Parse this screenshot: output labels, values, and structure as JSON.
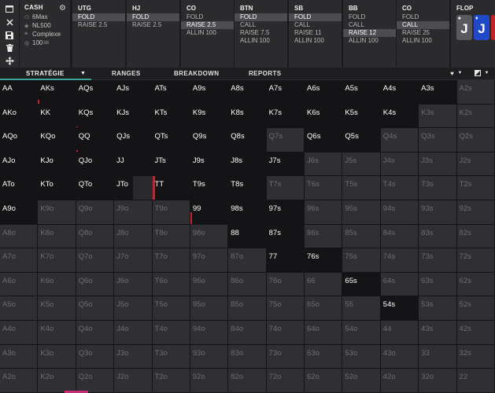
{
  "toolbar": {
    "icons": [
      "window-icon",
      "close-icon",
      "save-icon",
      "trash-icon",
      "move-icon"
    ]
  },
  "settings": {
    "title": "CASH",
    "rows": [
      {
        "icon": "players-icon",
        "text": "6Max",
        "suffix": ""
      },
      {
        "icon": "tag-icon",
        "text": "NL500",
        "suffix": ""
      },
      {
        "icon": "layers-icon",
        "text": "Complexe",
        "suffix": ""
      },
      {
        "icon": "chips-icon",
        "text": "100",
        "suffix": "bb"
      }
    ]
  },
  "positions": [
    {
      "name": "UTG",
      "actions": [
        "FOLD",
        "RAISE 2.5"
      ],
      "selected": 0
    },
    {
      "name": "HJ",
      "actions": [
        "FOLD",
        "RAISE 2.5"
      ],
      "selected": 0
    },
    {
      "name": "CO",
      "actions": [
        "FOLD",
        "RAISE 2.5",
        "ALLIN 100"
      ],
      "selected": 1
    },
    {
      "name": "BTN",
      "actions": [
        "FOLD",
        "CALL",
        "RAISE 7.5",
        "ALLIN 100"
      ],
      "selected": 0
    },
    {
      "name": "SB",
      "actions": [
        "FOLD",
        "CALL",
        "RAISE 11",
        "ALLIN 100"
      ],
      "selected": 0
    },
    {
      "name": "BB",
      "actions": [
        "FOLD",
        "CALL",
        "RAISE 12",
        "ALLIN 100"
      ],
      "selected": 2
    },
    {
      "name": "CO",
      "actions": [
        "FOLD",
        "CALL",
        "RAISE 25",
        "ALLIN 100"
      ],
      "selected": 1
    }
  ],
  "flop": {
    "title": "FLOP",
    "cards": [
      {
        "rank": "J",
        "suit": "♠",
        "color": "#5a5a5e"
      },
      {
        "rank": "J",
        "suit": "♦",
        "color": "#1f49c8"
      },
      {
        "rank": "",
        "suit": "",
        "color": "#c02226"
      }
    ]
  },
  "tabs": {
    "strategie": "STRATÉGIE",
    "ranges": "RANGES",
    "breakdown": "BREAKDOWN",
    "reports": "REPORTS"
  },
  "grid": {
    "rows": [
      [
        "AA",
        "AKs",
        "AQs",
        "AJs",
        "ATs",
        "A9s",
        "A8s",
        "A7s",
        "A6s",
        "A5s",
        "A4s",
        "A3s",
        "A2s"
      ],
      [
        "AKo",
        "KK",
        "KQs",
        "KJs",
        "KTs",
        "K9s",
        "K8s",
        "K7s",
        "K6s",
        "K5s",
        "K4s",
        "K3s",
        "K2s"
      ],
      [
        "AQo",
        "KQo",
        "QQ",
        "QJs",
        "QTs",
        "Q9s",
        "Q8s",
        "Q7s",
        "Q6s",
        "Q5s",
        "Q4s",
        "Q3s",
        "Q2s"
      ],
      [
        "AJo",
        "KJo",
        "QJo",
        "JJ",
        "JTs",
        "J9s",
        "J8s",
        "J7s",
        "J6s",
        "J5s",
        "J4s",
        "J3s",
        "J2s"
      ],
      [
        "ATo",
        "KTo",
        "QTo",
        "JTo",
        "TT",
        "T9s",
        "T8s",
        "T7s",
        "T6s",
        "T5s",
        "T4s",
        "T3s",
        "T2s"
      ],
      [
        "A9o",
        "K9o",
        "Q9o",
        "J9o",
        "T9o",
        "99",
        "98s",
        "97s",
        "96s",
        "95s",
        "94s",
        "93s",
        "92s"
      ],
      [
        "A8o",
        "K8o",
        "Q8o",
        "J8o",
        "T8o",
        "98o",
        "88",
        "87s",
        "86s",
        "85s",
        "84s",
        "83s",
        "82s"
      ],
      [
        "A7o",
        "K7o",
        "Q7o",
        "J7o",
        "T7o",
        "97o",
        "87o",
        "77",
        "76s",
        "75s",
        "74s",
        "73s",
        "72s"
      ],
      [
        "A6o",
        "K6o",
        "Q6o",
        "J6o",
        "T6o",
        "96o",
        "86o",
        "76o",
        "66",
        "65s",
        "64s",
        "63s",
        "62s"
      ],
      [
        "A5o",
        "K5o",
        "Q5o",
        "J5o",
        "T5o",
        "95o",
        "85o",
        "75o",
        "65o",
        "55",
        "54s",
        "53s",
        "52s"
      ],
      [
        "A4o",
        "K4o",
        "Q4o",
        "J4o",
        "T4o",
        "94o",
        "84o",
        "74o",
        "64o",
        "54o",
        "44",
        "43s",
        "42s"
      ],
      [
        "A3o",
        "K3o",
        "Q3o",
        "J3o",
        "T3o",
        "93o",
        "83o",
        "73o",
        "63o",
        "53o",
        "43o",
        "33",
        "32s"
      ],
      [
        "A2o",
        "K2o",
        "Q2o",
        "J2o",
        "T2o",
        "92o",
        "82o",
        "72o",
        "62o",
        "52o",
        "42o",
        "32o",
        "22"
      ]
    ],
    "active": [
      [
        1,
        1,
        1,
        1,
        1,
        1,
        1,
        1,
        1,
        1,
        1,
        1,
        0
      ],
      [
        1,
        1,
        1,
        1,
        1,
        1,
        1,
        1,
        1,
        1,
        1,
        0,
        0
      ],
      [
        1,
        1,
        1,
        1,
        1,
        1,
        1,
        0,
        1,
        1,
        0,
        0,
        0
      ],
      [
        1,
        1,
        1,
        1,
        1,
        1,
        1,
        1,
        0,
        0,
        0,
        0,
        0
      ],
      [
        1,
        1,
        1,
        1,
        1,
        1,
        1,
        0,
        0,
        0,
        0,
        0,
        0
      ],
      [
        1,
        0,
        0,
        0,
        0,
        1,
        1,
        1,
        0,
        0,
        0,
        0,
        0
      ],
      [
        0,
        0,
        0,
        0,
        0,
        0,
        1,
        1,
        0,
        0,
        0,
        0,
        0
      ],
      [
        0,
        0,
        0,
        0,
        0,
        0,
        0,
        1,
        1,
        0,
        0,
        0,
        0
      ],
      [
        0,
        0,
        0,
        0,
        0,
        0,
        0,
        0,
        0,
        1,
        0,
        0,
        0
      ],
      [
        0,
        0,
        0,
        0,
        0,
        0,
        0,
        0,
        0,
        0,
        1,
        0,
        0
      ],
      [
        0,
        0,
        0,
        0,
        0,
        0,
        0,
        0,
        0,
        0,
        0,
        0,
        0
      ],
      [
        0,
        0,
        0,
        0,
        0,
        0,
        0,
        0,
        0,
        0,
        0,
        0,
        0
      ],
      [
        0,
        0,
        0,
        0,
        0,
        0,
        0,
        0,
        0,
        0,
        0,
        0,
        0
      ]
    ],
    "raise_fraction": [
      [
        0,
        0.15,
        0,
        0,
        0,
        0,
        0,
        0,
        0,
        0,
        0,
        0,
        0
      ],
      [
        0,
        0,
        0.05,
        0,
        0,
        0,
        0,
        0,
        0,
        0,
        0,
        0,
        0
      ],
      [
        0,
        0,
        0.05,
        0,
        0,
        0,
        0,
        0,
        0,
        0,
        0,
        0,
        0
      ],
      [
        0,
        0,
        0,
        0,
        0,
        0,
        0,
        0,
        0,
        0,
        0,
        0,
        0
      ],
      [
        0,
        0,
        0,
        0,
        0.97,
        0,
        0,
        0,
        0,
        0,
        0,
        0,
        0
      ],
      [
        0,
        0,
        0,
        0,
        0,
        0.5,
        0,
        0,
        0,
        0,
        0,
        0,
        0
      ],
      [
        0,
        0,
        0,
        0,
        0,
        0,
        0,
        0,
        0,
        0,
        0,
        0,
        0
      ],
      [
        0,
        0,
        0,
        0,
        0,
        0,
        0,
        0,
        0,
        0,
        0,
        0,
        0
      ],
      [
        0,
        0,
        0,
        0,
        0,
        0,
        0,
        0,
        0,
        0,
        0,
        0,
        0
      ],
      [
        0,
        0,
        0,
        0,
        0,
        0,
        0,
        0,
        0,
        0,
        0,
        0,
        0
      ],
      [
        0,
        0,
        0,
        0,
        0,
        0,
        0,
        0,
        0,
        0,
        0,
        0,
        0
      ],
      [
        0,
        0,
        0,
        0,
        0,
        0,
        0,
        0,
        0,
        0,
        0,
        0,
        0
      ],
      [
        0,
        0,
        0,
        0,
        0,
        0,
        0,
        0,
        0,
        0,
        0,
        0,
        0
      ]
    ],
    "colors": {
      "raise": "#c1262c",
      "active_bg": "#141416",
      "inactive_bg": "#303034"
    }
  }
}
